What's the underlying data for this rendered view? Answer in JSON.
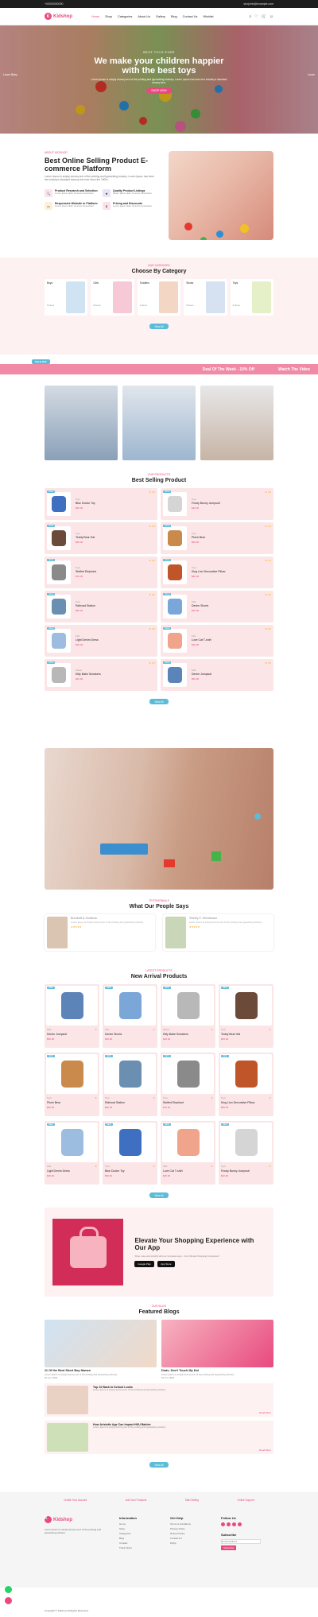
{
  "topbar": {
    "phone": "+00000000000",
    "email": "shopinfo@example.com"
  },
  "header": {
    "logo": "Kidshop",
    "nav": [
      "Home",
      "Shop",
      "Categories",
      "About Us",
      "Gallery",
      "Blog",
      "Contact Us",
      "Wishlist"
    ]
  },
  "hero": {
    "kicker": "BEST TOYS EVER",
    "title": "We make your children happier with the best toys",
    "text": "Lorem Ipsum is simply dummy text of the printing and typesetting industry. Lorem Ipsum has been the industry's standard dummy text.",
    "button": "SHOP NOW",
    "side_left": "Learn Baby",
    "side_right": "Learn"
  },
  "about": {
    "kicker": "ABOUT KIDSHOP",
    "title": "Best Online Selling Product E-commerce Platform",
    "text": "Lorem Ipsum is simply dummy text of the printing and typesetting industry. Lorem Ipsum has been the industry's standard dummy text ever since the 1500s.",
    "features": [
      {
        "title": "Product Research and Selection",
        "text": "Lorem ipsum dolor sit amet consectetur",
        "color": "#e84a7f"
      },
      {
        "title": "Quality Product Listings",
        "text": "Lorem ipsum dolor sit amet consectetur",
        "color": "#8e7cc3"
      },
      {
        "title": "Responsive Website or Platform",
        "text": "Lorem ipsum dolor sit amet consectetur",
        "color": "#f5a623"
      },
      {
        "title": "Pricing and Discounts",
        "text": "Lorem ipsum dolor sit amet consectetur",
        "color": "#e84a7f"
      }
    ]
  },
  "categories": {
    "kicker": "OUR CATEGORY",
    "title": "Choose By Category",
    "items": [
      {
        "name": "Boys",
        "count": "6 Items"
      },
      {
        "name": "Girls",
        "count": "8 Items"
      },
      {
        "name": "Toddlers",
        "count": "4 Items"
      },
      {
        "name": "Shoes",
        "count": "5 Items"
      },
      {
        "name": "Toys",
        "count": "6 Items"
      }
    ],
    "button": "View All"
  },
  "marquee": {
    "tag": "SALE OFF",
    "text1": "Deal Of The Week - 10% Off",
    "text2": "Watch The Video"
  },
  "best": {
    "kicker": "OUR PRODUCTS",
    "title": "Best Selling Product",
    "products": [
      {
        "cat": "Toys",
        "name": "Blue Doctor Toy",
        "price": "$50.00",
        "rating": "4.5"
      },
      {
        "cat": "Toys",
        "name": "Frosty Bunny Jumpsuit",
        "price": "$40.00",
        "rating": "4.5"
      },
      {
        "cat": "Toys",
        "name": "Teddy Bear Hat",
        "price": "$45.00",
        "rating": "4.5"
      },
      {
        "cat": "Toys",
        "name": "Plush Bear",
        "price": "$60.00",
        "rating": "4.5"
      },
      {
        "cat": "Toys",
        "name": "Stuffed Elephant",
        "price": "$70.00",
        "rating": "4.5"
      },
      {
        "cat": "Toys",
        "name": "King Lion Decorative Pillow",
        "price": "$80.00",
        "rating": "4.5"
      },
      {
        "cat": "Toys",
        "name": "Railroad Station",
        "price": "$90.00",
        "rating": "4.5"
      },
      {
        "cat": "Kids",
        "name": "Denim Shorts",
        "price": "$30.00",
        "rating": "4.5"
      },
      {
        "cat": "Kids",
        "name": "Light Denim Dress",
        "price": "$35.00",
        "rating": "4.5"
      },
      {
        "cat": "Kids",
        "name": "Love Cat T-shirt",
        "price": "$25.00",
        "rating": "4.5"
      },
      {
        "cat": "Shoes",
        "name": "Kitty Babe Sneakers",
        "price": "$40.00",
        "rating": "4.5"
      },
      {
        "cat": "Kids",
        "name": "Denim Jumpsuit",
        "price": "$50.00",
        "rating": "4.5"
      }
    ],
    "button": "View All"
  },
  "testimonials": {
    "kicker": "TESTIMONIALS",
    "title": "What Our People Says",
    "items": [
      {
        "name": "Brockett & Goldens",
        "text": "Lorem Ipsum is simply dummy text of the printing and typesetting industry.",
        "stars": "★★★★★"
      },
      {
        "name": "Shirley F. Henderson",
        "text": "Lorem Ipsum is simply dummy text of the printing and typesetting industry.",
        "stars": "★★★★★"
      }
    ]
  },
  "arrivals": {
    "kicker": "LATEST PRODUCTS",
    "title": "New Arrival Products",
    "products": [
      {
        "cat": "Kids",
        "name": "Denim Jumpsuit",
        "price": "$50.00",
        "color": "#5d84b8"
      },
      {
        "cat": "Kids",
        "name": "Denim Shorts",
        "price": "$30.00",
        "color": "#7aa6d8"
      },
      {
        "cat": "Shoes",
        "name": "Kitty Babe Sneakers",
        "price": "$40.00",
        "color": "#b8b8b8"
      },
      {
        "cat": "Toys",
        "name": "Teddy Bear Hat",
        "price": "$45.00",
        "color": "#6b4a3a"
      },
      {
        "cat": "Toys",
        "name": "Plush Bear",
        "price": "$60.00",
        "color": "#c98a4b"
      },
      {
        "cat": "Toys",
        "name": "Railroad Station",
        "price": "$90.00",
        "color": "#6a8fb0"
      },
      {
        "cat": "Toys",
        "name": "Stuffed Elephant",
        "price": "$70.00",
        "color": "#8a8a8a"
      },
      {
        "cat": "Toys",
        "name": "King Lion Decorative Pillow",
        "price": "$80.00",
        "color": "#c0552a"
      },
      {
        "cat": "Kids",
        "name": "Light Denim Dress",
        "price": "$35.00",
        "color": "#9dbde0"
      },
      {
        "cat": "Toys",
        "name": "Blue Doctor Toy",
        "price": "$50.00",
        "color": "#3f6fc1"
      },
      {
        "cat": "Kids",
        "name": "Love Cat T-shirt",
        "price": "$25.00",
        "color": "#f0a48c"
      },
      {
        "cat": "Toys",
        "name": "Frosty Bunny Jumpsuit",
        "price": "$40.00",
        "color": "#d5d5d5"
      }
    ],
    "button": "View All"
  },
  "app": {
    "title": "Elevate Your Shopping Experience with Our App",
    "text": "Shop, save and simplify with our innovative app - Your Ultimate Shopping Companion!",
    "google": "Google Play",
    "apple": "App Store"
  },
  "blog": {
    "kicker": "OUR BLOG",
    "title": "Featured Blogs",
    "items": [
      {
        "title": "11 Of the Best Short Boy Names",
        "text": "Lorem Ipsum is simply dummy text of the printing and typesetting industry.",
        "date": "15 Jun, 2023"
      },
      {
        "title": "Dude, Don't Touch My Kid",
        "text": "Lorem Ipsum is simply dummy text of the printing and typesetting industry.",
        "date": "15 Jun, 2023"
      }
    ],
    "rows": [
      {
        "title": "Top 10 Back to School Looks",
        "text": "Lorem Ipsum is simply dummy text of the printing and typesetting industry.",
        "more": "Read More"
      },
      {
        "title": "How Aristotle Age Can Impact HKU Babies",
        "text": "Lorem Ipsum is simply dummy text of the printing and typesetting industry.",
        "more": "Read More"
      }
    ],
    "button": "View All"
  },
  "services": [
    "Create Your Account",
    "Add Your Products",
    "Start Selling",
    "Online Support"
  ],
  "footer": {
    "logo": "Kidshop",
    "about": "Lorem Ipsum is simply dummy text of the printing and typesetting industry.",
    "info_title": "Information",
    "info": [
      "Home",
      "Shop",
      "Categories",
      "Blog",
      "Contact",
      "Track Order"
    ],
    "help_title": "Get Help",
    "help": [
      "Terms & Conditions",
      "Privacy Policy",
      "Refund Policy",
      "Contact Us",
      "FAQs"
    ],
    "follow_title": "Follow Us",
    "sub_title": "Subscribe",
    "sub_placeholder": "Email Address",
    "sub_btn": "Subscribe",
    "copy": "Copyright © Kidshop All Rights Reserved."
  }
}
